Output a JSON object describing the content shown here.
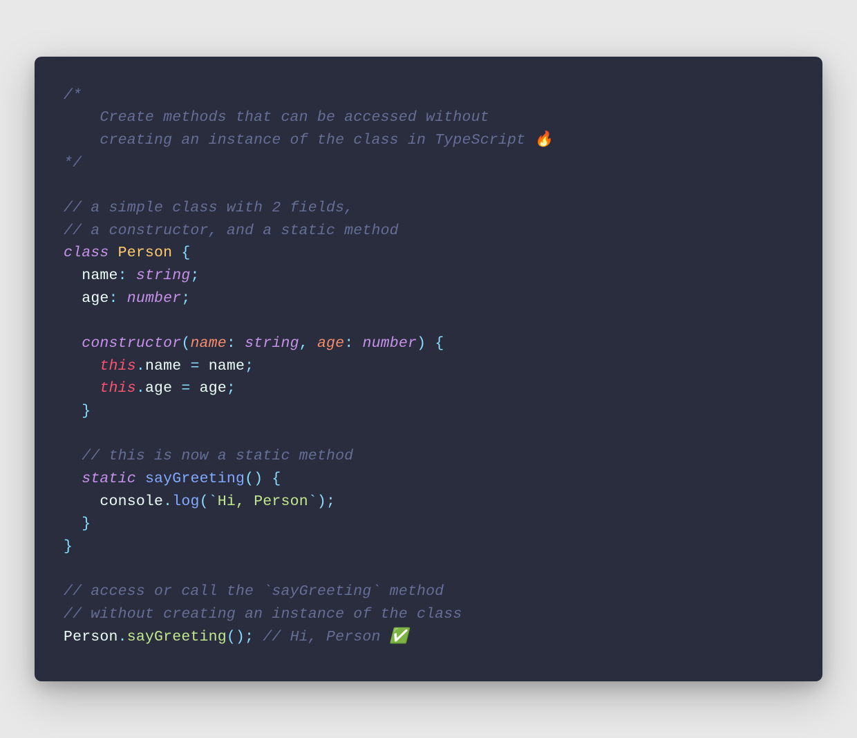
{
  "code": {
    "blockComment": {
      "open": "/*",
      "line1": "    Create methods that can be accessed without",
      "line2": "    creating an instance of the class in TypeScript 🔥",
      "close": "*/"
    },
    "comment1a": "// a simple class with 2 fields,",
    "comment1b": "// a constructor, and a static method",
    "kw_class": "class",
    "className": "Person",
    "brace_open": "{",
    "field1_name": "name",
    "colon": ":",
    "type_string": "string",
    "semi": ";",
    "field2_name": "age",
    "type_number": "number",
    "kw_constructor": "constructor",
    "paren_open": "(",
    "param1": "name",
    "param2": "age",
    "paren_close": ")",
    "kw_this": "this",
    "dot": ".",
    "assign_name": "name",
    "eq": "=",
    "var_name": "name",
    "assign_age": "age",
    "var_age": "age",
    "brace_close": "}",
    "comment2": "// this is now a static method",
    "kw_static": "static",
    "method_sayGreeting": "sayGreeting",
    "obj_console": "console",
    "method_log": "log",
    "backtick": "`",
    "str_hi": "Hi, Person",
    "comment3a": "// access or call the `sayGreeting` method",
    "comment3b": "// without creating an instance of the class",
    "call_Person": "Person",
    "call_method": "sayGreeting",
    "comment4": "// Hi, Person ✅"
  }
}
